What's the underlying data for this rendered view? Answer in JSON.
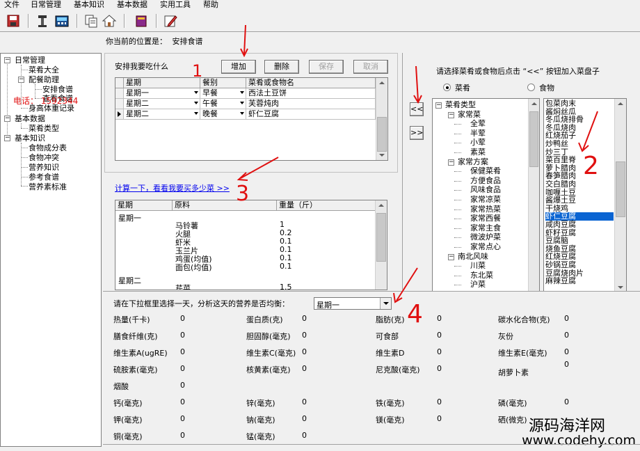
{
  "menu": [
    "文件",
    "日常管理",
    "基本知识",
    "基本数据",
    "实用工具",
    "帮助"
  ],
  "toolbar_icons": [
    "save-icon",
    "tool-icon",
    "calculator-icon",
    "copy-icon",
    "home-icon",
    "book-icon",
    "edit-icon"
  ],
  "location": {
    "label": "你当前的位置是：",
    "value": "安排食谱"
  },
  "left_tree": {
    "groups": [
      {
        "label": "日常管理",
        "items": [
          {
            "label": "菜肴大全"
          },
          {
            "label": "配餐助理",
            "children": [
              "安排食谱",
              "查看食谱"
            ]
          },
          {
            "label": "身高体重记录"
          }
        ]
      },
      {
        "label": "基本数据",
        "items": [
          {
            "label": "菜肴类型"
          }
        ]
      },
      {
        "label": "基本知识",
        "items": [
          {
            "label": "食物成分表"
          },
          {
            "label": "食物冲突"
          },
          {
            "label": "营养知识"
          },
          {
            "label": "参考食谱"
          },
          {
            "label": "营养素标准"
          }
        ]
      }
    ],
    "overlay_text": "电话：    1592344"
  },
  "plan": {
    "title": "安排我要吃什么",
    "buttons": {
      "add": "增加",
      "delete": "删除",
      "save": "保存",
      "cancel": "取消"
    },
    "columns": [
      "星期",
      "餐别",
      "菜肴或食物名"
    ],
    "rows": [
      {
        "day": "星期一",
        "meal": "早餐",
        "dish": "西法土豆饼"
      },
      {
        "day": "星期二",
        "meal": "午餐",
        "dish": "芙蓉炖肉"
      },
      {
        "day": "星期二",
        "meal": "晚餐",
        "dish": "虾仁豆腐"
      }
    ]
  },
  "calc_link": "计算一下，看看我要买多少菜 >>",
  "materials": {
    "columns": [
      "星期",
      "原料",
      "重量（斤）"
    ],
    "groups": [
      {
        "day": "星期一",
        "items": [
          {
            "name": "马铃薯",
            "weight": "1"
          },
          {
            "name": "火腿",
            "weight": "0.2"
          },
          {
            "name": "虾米",
            "weight": "0.1"
          },
          {
            "name": "玉兰片",
            "weight": "0.1"
          },
          {
            "name": "鸡蛋(均值)",
            "weight": "0.1"
          },
          {
            "name": "面包(均值)",
            "weight": "0.1"
          }
        ]
      },
      {
        "day": "星期二",
        "items": [
          {
            "name": "芹菜",
            "weight": "1.5"
          }
        ]
      }
    ]
  },
  "right": {
    "instruction": "请选择菜肴或食物后点击 “<<” 按钮加入菜盘子",
    "radio": {
      "dish": "菜肴",
      "food": "食物",
      "selected": "dish"
    },
    "btn_add": "<<",
    "btn_remove": ">>",
    "tree": [
      {
        "label": "菜肴类型",
        "level": 0,
        "box": "-"
      },
      {
        "label": "家常菜",
        "level": 1,
        "box": "-"
      },
      {
        "label": "全荤",
        "level": 2
      },
      {
        "label": "半荤",
        "level": 2
      },
      {
        "label": "小荤",
        "level": 2
      },
      {
        "label": "素菜",
        "level": 2
      },
      {
        "label": "家常方案",
        "level": 1,
        "box": "-"
      },
      {
        "label": "保健菜肴",
        "level": 2
      },
      {
        "label": "方便食品",
        "level": 2
      },
      {
        "label": "风味食品",
        "level": 2
      },
      {
        "label": "家常凉菜",
        "level": 2
      },
      {
        "label": "家常热菜",
        "level": 2
      },
      {
        "label": "家常西餐",
        "level": 2
      },
      {
        "label": "家常主食",
        "level": 2
      },
      {
        "label": "微波炉菜",
        "level": 2
      },
      {
        "label": "家常点心",
        "level": 2
      },
      {
        "label": "南北风味",
        "level": 1,
        "box": "-"
      },
      {
        "label": "川菜",
        "level": 2
      },
      {
        "label": "东北菜",
        "level": 2
      },
      {
        "label": "沪菜",
        "level": 2
      }
    ],
    "list": [
      "包菜肉末",
      "酱焖丝瓜",
      "冬瓜烧排骨",
      "冬瓜烧肉",
      "红烧茄子",
      "炒鸭丝",
      "炒三丁",
      "菜百里脊",
      "萝卜腊肉",
      "春笋腊肉",
      "交白腊肉",
      "咖喱土豆",
      "酱爆土豆",
      "干烧鸡",
      "虾仁豆腐",
      "咸肉豆腐",
      "虾籽豆腐",
      "豆腐脑",
      "烧鱼豆腐",
      "红烧豆腐",
      "砂锅豆腐",
      "豆腐烧肉片",
      "麻辣豆腐"
    ],
    "selected_index": 14
  },
  "nutrition": {
    "prompt": "请在下拉框里选择一天，分析这天的营养是否均衡：",
    "day": "星期一",
    "items": [
      {
        "label": "热量(千卡)",
        "value": "0"
      },
      {
        "label": "蛋白质(克)",
        "value": "0"
      },
      {
        "label": "脂肪(克)",
        "value": "0"
      },
      {
        "label": "碳水化合物(克)",
        "value": "0"
      },
      {
        "label": "膳食纤维(克)",
        "value": "0"
      },
      {
        "label": "胆固醇(毫克)",
        "value": "0"
      },
      {
        "label": "可食部",
        "value": "0"
      },
      {
        "label": "灰份",
        "value": "0"
      },
      {
        "label": "维生素A(ugRE)",
        "value": "0"
      },
      {
        "label": "维生素C(毫克)",
        "value": "0"
      },
      {
        "label": "维生素D",
        "value": "0"
      },
      {
        "label": "维生素E(毫克)",
        "value": "0"
      },
      {
        "label": "硫胺素(毫克)",
        "value": "0"
      },
      {
        "label": "核黄素(毫克)",
        "value": "0"
      },
      {
        "label": "尼克酸(毫克)",
        "value": "0"
      },
      {
        "label": "胡萝卜素",
        "value": "0"
      },
      {
        "label": "烟酸",
        "value": "0"
      },
      {
        "label": "钙(毫克)",
        "value": "0"
      },
      {
        "label": "锌(毫克)",
        "value": "0"
      },
      {
        "label": "铁(毫克)",
        "value": "0"
      },
      {
        "label": "磷(毫克)",
        "value": "0"
      },
      {
        "label": "钾(毫克)",
        "value": "0"
      },
      {
        "label": "钠(毫克)",
        "value": "0"
      },
      {
        "label": "镁(毫克)",
        "value": "0"
      },
      {
        "label": "硒(微克)",
        "value": ""
      },
      {
        "label": "铜(毫克)",
        "value": "0"
      },
      {
        "label": "锰(毫克)",
        "value": "0"
      }
    ]
  },
  "annotations": [
    "1",
    "2",
    "3",
    "4"
  ],
  "watermark": {
    "line1": "源码海洋网",
    "line2": "www.codehy.com"
  },
  "colors": {
    "selection": "#0a64d2",
    "link": "#0000ee",
    "annotation": "#e01010"
  }
}
